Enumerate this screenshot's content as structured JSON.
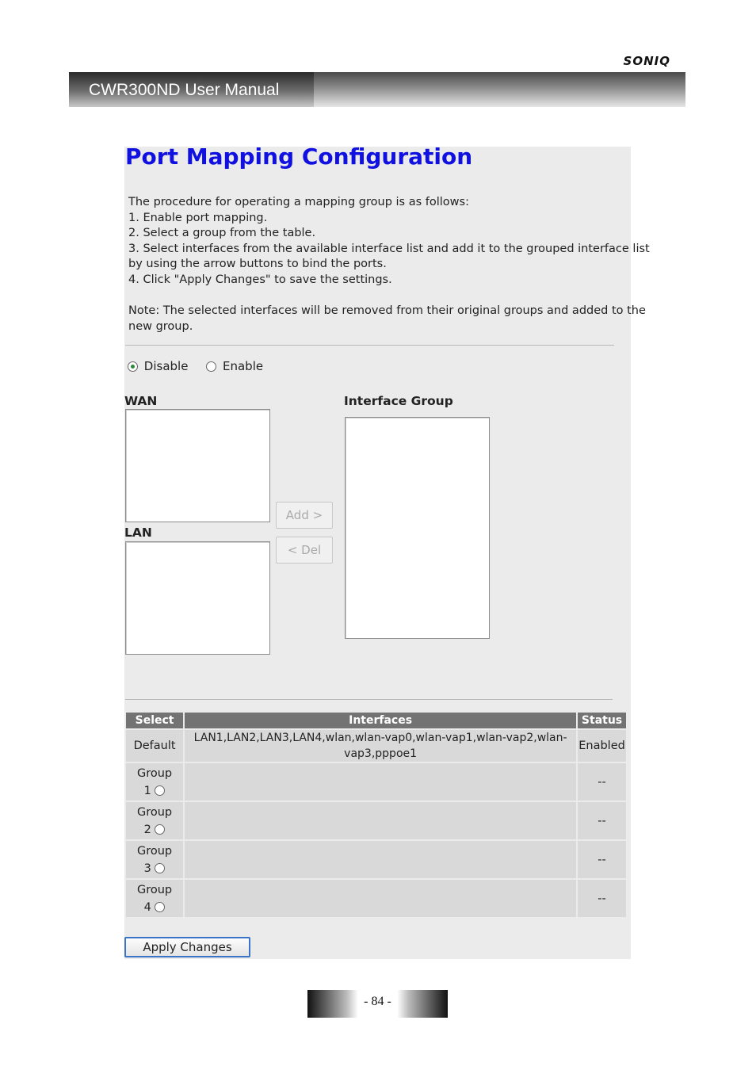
{
  "brand": "SONIQ",
  "manual_title": "CWR300ND User Manual",
  "page_title": "Port Mapping Configuration",
  "instructions": [
    "The procedure for operating a mapping group is as follows:",
    "1. Enable port mapping.",
    "2. Select a group from the table.",
    "3. Select interfaces from the available interface list and add it to the grouped interface list",
    "by using the arrow buttons to bind the ports.",
    "4. Click \"Apply Changes\" to save the settings."
  ],
  "note": [
    "Note: The selected interfaces will be removed from their original groups and added to the",
    "new group."
  ],
  "mode": {
    "disable_label": "Disable",
    "enable_label": "Enable",
    "selected": "Disable"
  },
  "lists": {
    "wan_label": "WAN",
    "lan_label": "LAN",
    "group_label": "Interface Group"
  },
  "buttons": {
    "add": "Add >",
    "del": "< Del",
    "apply": "Apply Changes"
  },
  "table": {
    "headers": [
      "Select",
      "Interfaces",
      "Status"
    ],
    "rows": [
      {
        "select": "Default",
        "interfaces_l1": "LAN1,LAN2,LAN3,LAN4,wlan,wlan-vap0,wlan-vap1,wlan-vap2,wlan-",
        "interfaces_l2": "vap3,pppoe1",
        "status": "Enabled"
      },
      {
        "select_l1": "Group",
        "select_l2": "1",
        "interfaces": "",
        "status": "--"
      },
      {
        "select_l1": "Group",
        "select_l2": "2",
        "interfaces": "",
        "status": "--"
      },
      {
        "select_l1": "Group",
        "select_l2": "3",
        "interfaces": "",
        "status": "--"
      },
      {
        "select_l1": "Group",
        "select_l2": "4",
        "interfaces": "",
        "status": "--"
      }
    ]
  },
  "page_number": "- 84 -"
}
